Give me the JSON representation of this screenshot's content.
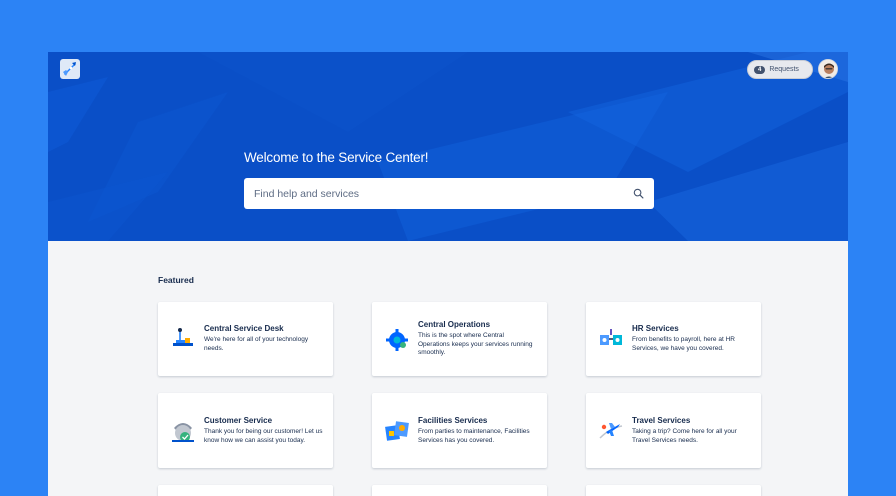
{
  "header": {
    "requests": {
      "count": "4",
      "label": "Requests"
    }
  },
  "hero": {
    "title": "Welcome to the Service Center!",
    "search_placeholder": "Find help and services"
  },
  "featured": {
    "heading": "Featured",
    "cards": [
      {
        "title": "Central Service Desk",
        "description": "We're here for all of your technology needs.",
        "icon": "service-desk-icon"
      },
      {
        "title": "Central Operations",
        "description": "This is the spot where Central Operations keeps your services running smoothly.",
        "icon": "operations-gear-icon"
      },
      {
        "title": "HR Services",
        "description": "From benefits to payroll, here at HR Services, we have you covered.",
        "icon": "hr-services-icon"
      },
      {
        "title": "Customer Service",
        "description": "Thank you for being our customer! Let us know how we can assist you today.",
        "icon": "customer-service-icon"
      },
      {
        "title": "Facilities Services",
        "description": "From parties to maintenance, Facilities Services has you covered.",
        "icon": "facilities-icon"
      },
      {
        "title": "Travel Services",
        "description": "Taking a trip? Come here for all your Travel Services needs.",
        "icon": "travel-plane-icon"
      }
    ]
  },
  "colors": {
    "page_bg": "#2c83f5",
    "hero_bg": "#0a4fc7",
    "content_bg": "#f4f5f7",
    "text": "#172b4d"
  }
}
